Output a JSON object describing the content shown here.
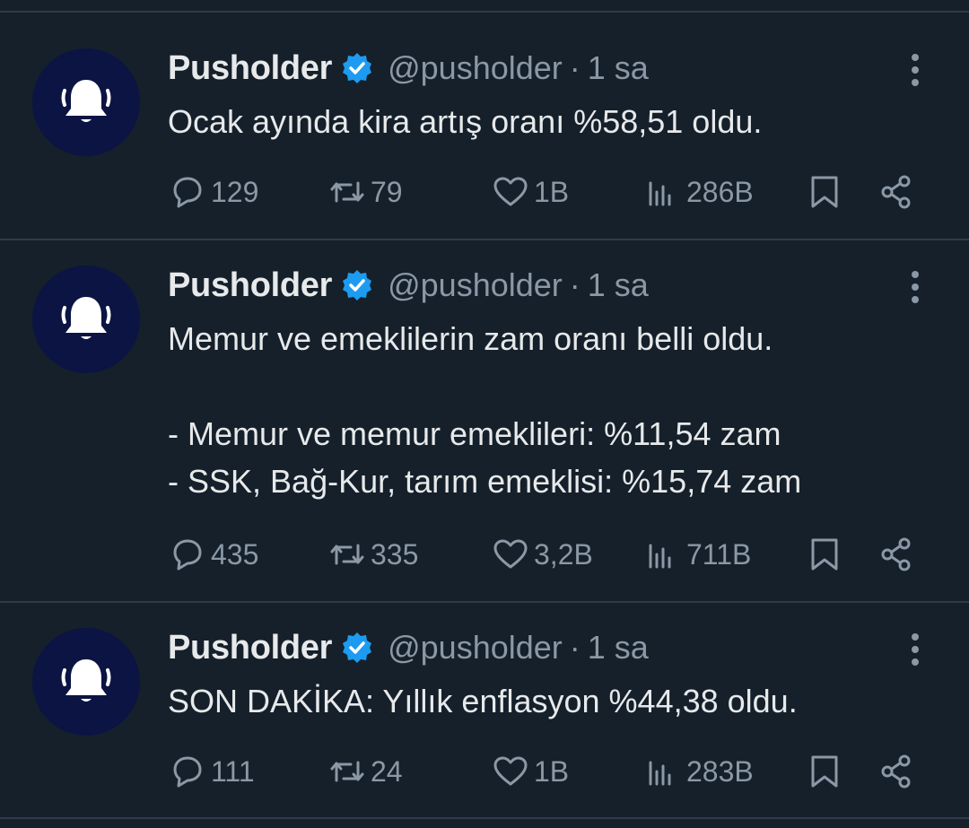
{
  "tweets": [
    {
      "name": "Pusholder",
      "handle": "@pusholder",
      "separator": "·",
      "time": "1 sa",
      "text": "Ocak ayında kira artış oranı %58,51 oldu.",
      "replies": "129",
      "retweets": "79",
      "likes": "1B",
      "views": "286B"
    },
    {
      "name": "Pusholder",
      "handle": "@pusholder",
      "separator": "·",
      "time": "1 sa",
      "text": "Memur ve emeklilerin zam oranı belli oldu.\n\n- Memur ve memur emeklileri: %11,54 zam\n- SSK, Bağ-Kur, tarım emeklisi: %15,74 zam",
      "replies": "435",
      "retweets": "335",
      "likes": "3,2B",
      "views": "711B"
    },
    {
      "name": "Pusholder",
      "handle": "@pusholder",
      "separator": "·",
      "time": "1 sa",
      "text": "SON DAKİKA: Yıllık enflasyon %44,38 oldu.",
      "replies": "111",
      "retweets": "24",
      "likes": "1B",
      "views": "283B"
    }
  ],
  "colors": {
    "background": "#15202b",
    "divider": "#2f3b47",
    "text_primary": "#e7e9ea",
    "text_secondary": "#8b98a5",
    "verified_blue": "#1d9bf0",
    "avatar_bg": "#0b1443"
  },
  "icons": {
    "avatar": "bell-alert-icon",
    "verified": "verified-badge-icon",
    "more": "more-vertical-icon",
    "reply": "reply-icon",
    "retweet": "retweet-icon",
    "like": "heart-icon",
    "views": "views-chart-icon",
    "bookmark": "bookmark-icon",
    "share": "share-icon"
  }
}
